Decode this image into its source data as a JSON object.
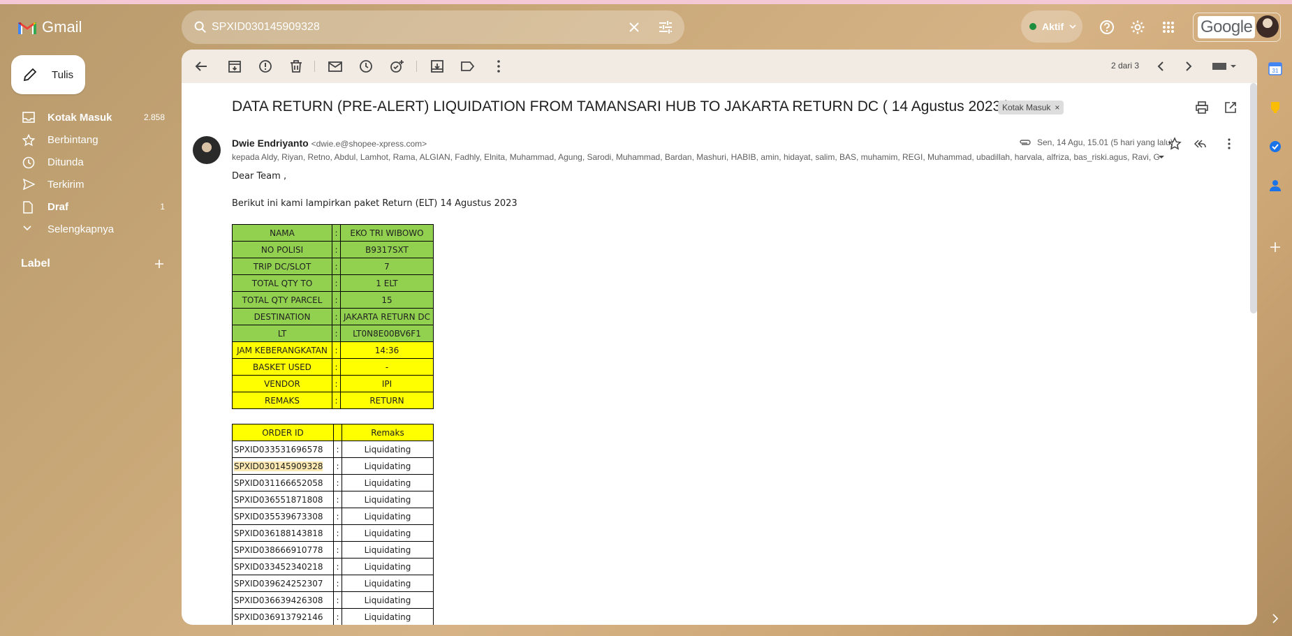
{
  "app": {
    "name": "Gmail"
  },
  "search": {
    "value": "SPXID030145909328"
  },
  "status": {
    "label": "Aktif"
  },
  "account": {
    "brand": "Google"
  },
  "compose": {
    "label": "Tulis"
  },
  "nav": {
    "items": [
      {
        "label": "Kotak Masuk",
        "count": "2.858",
        "icon": "inbox-icon",
        "bold": true
      },
      {
        "label": "Berbintang",
        "count": "",
        "icon": "star-icon",
        "bold": false
      },
      {
        "label": "Ditunda",
        "count": "",
        "icon": "clock-icon",
        "bold": false
      },
      {
        "label": "Terkirim",
        "count": "",
        "icon": "send-icon",
        "bold": false
      },
      {
        "label": "Draf",
        "count": "1",
        "icon": "draft-icon",
        "bold": true
      },
      {
        "label": "Selengkapnya",
        "count": "",
        "icon": "chevron-down-icon",
        "bold": false
      }
    ],
    "labels_heading": "Label"
  },
  "toolbar": {
    "pager": "2 dari 3"
  },
  "message": {
    "subject": "DATA RETURN (PRE-ALERT) LIQUIDATION FROM TAMANSARI HUB TO JAKARTA RETURN DC ( 14 Agustus 2023 )",
    "label_chip": "Kotak Masuk",
    "sender_name": "Dwie Endriyanto",
    "sender_email": "<dwie.e@shopee-xpress.com>",
    "date": "Sen, 14 Agu, 15.01 (5 hari yang lalu)",
    "to": "kepada Aldy, Riyan, Retno, Abdul, Lamhot, Rama, ALGIAN, Fadhly, Elnita, Muhammad, Agung, Sarodi, Muhammad, Bardan, Mashuri, HABIB, amin, hidayat, salim, BAS, muhamim, REGI, Muhammad, ubadillah, harvala, alfriza, bas_riski.agus, Ravi, G",
    "greeting": "Dear Team ,",
    "intro": "Berikut ini kami lampirkan paket Return (ELT) 14 Agustus  2023",
    "info_rows": [
      {
        "key": "NAMA",
        "value": "EKO TRI WIBOWO",
        "color": "#92d050"
      },
      {
        "key": "NO POLISI",
        "value": "B9317SXT",
        "color": "#92d050"
      },
      {
        "key": "TRIP DC/SLOT",
        "value": "7",
        "color": "#92d050"
      },
      {
        "key": "TOTAL QTY TO",
        "value": "1 ELT",
        "color": "#92d050"
      },
      {
        "key": "TOTAL QTY PARCEL",
        "value": "15",
        "color": "#92d050"
      },
      {
        "key": "DESTINATION",
        "value": "JAKARTA RETURN DC",
        "color": "#92d050"
      },
      {
        "key": "LT",
        "value": "LT0N8E00BV6F1",
        "color": "#92d050"
      },
      {
        "key": "JAM KEBERANGKATAN",
        "value": "14:36",
        "color": "#ffff00"
      },
      {
        "key": "BASKET USED",
        "value": "-",
        "color": "#ffff00"
      },
      {
        "key": "VENDOR",
        "value": "IPI",
        "color": "#ffff00"
      },
      {
        "key": "REMAKS",
        "value": "RETURN",
        "color": "#ffff00"
      }
    ],
    "separator": ":",
    "orders_header": {
      "order_id": "ORDER ID",
      "remarks": "Remaks"
    },
    "orders": [
      {
        "id": "SPXID033531696578",
        "remarks": "Liquidating"
      },
      {
        "id": "SPXID030145909328",
        "remarks": "Liquidating",
        "highlight": true
      },
      {
        "id": "SPXID031166652058",
        "remarks": "Liquidating"
      },
      {
        "id": "SPXID036551871808",
        "remarks": "Liquidating"
      },
      {
        "id": "SPXID035539673308",
        "remarks": "Liquidating"
      },
      {
        "id": "SPXID036188143818",
        "remarks": "Liquidating"
      },
      {
        "id": "SPXID038666910778",
        "remarks": "Liquidating"
      },
      {
        "id": "SPXID033452340218",
        "remarks": "Liquidating"
      },
      {
        "id": "SPXID039624252307",
        "remarks": "Liquidating"
      },
      {
        "id": "SPXID036639426308",
        "remarks": "Liquidating"
      },
      {
        "id": "SPXID036913792146",
        "remarks": "Liquidating"
      }
    ]
  },
  "rightbar": {
    "calendar_day": "31"
  }
}
